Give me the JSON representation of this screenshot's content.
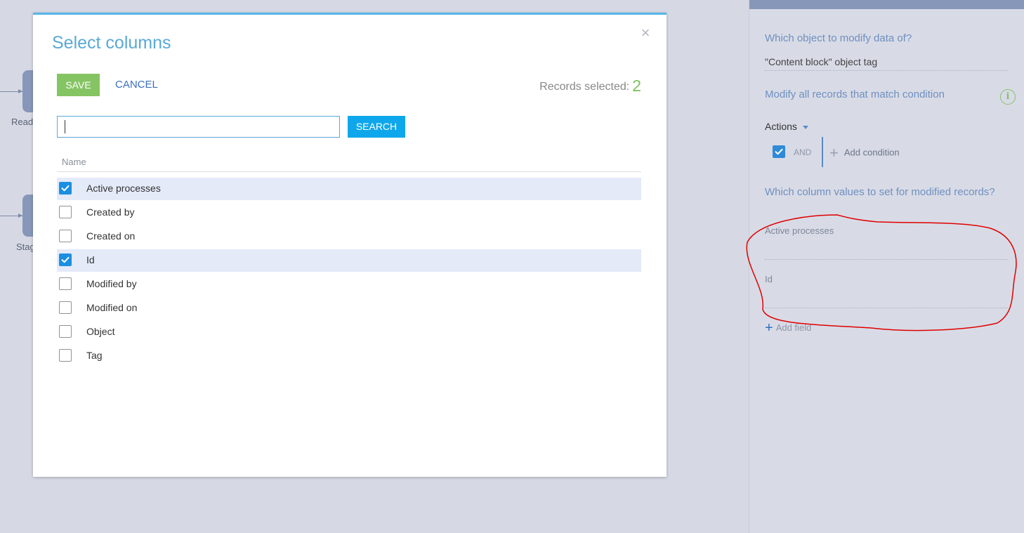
{
  "background": {
    "nodes": [
      {
        "label": "Read"
      },
      {
        "label": "Stag"
      }
    ]
  },
  "modal": {
    "title": "Select columns",
    "close_symbol": "×",
    "save_label": "SAVE",
    "cancel_label": "CANCEL",
    "records_selected_label": "Records selected:",
    "records_selected_count": "2",
    "search": {
      "value": "",
      "placeholder": ""
    },
    "search_button_label": "SEARCH",
    "column_header": "Name",
    "columns": [
      {
        "label": "Active processes",
        "checked": true
      },
      {
        "label": "Created by",
        "checked": false
      },
      {
        "label": "Created on",
        "checked": false
      },
      {
        "label": "Id",
        "checked": true
      },
      {
        "label": "Modified by",
        "checked": false
      },
      {
        "label": "Modified on",
        "checked": false
      },
      {
        "label": "Object",
        "checked": false
      },
      {
        "label": "Tag",
        "checked": false
      }
    ]
  },
  "right_panel": {
    "object_question": "Which object to modify data of?",
    "object_value": "\"Content block\" object tag",
    "condition_label": "Modify all records that match condition",
    "info_icon": "i",
    "actions_label": "Actions",
    "and_label": "AND",
    "add_condition_label": "Add condition",
    "columns_question": "Which column values to set for modified records?",
    "fields": [
      {
        "label": "Active processes"
      },
      {
        "label": "Id"
      }
    ],
    "add_field_label": "Add field"
  },
  "colors": {
    "accent_blue": "#5aa9d6",
    "save_green": "#85c463",
    "search_blue": "#0fa7ec",
    "checked_blue": "#1b8fe0",
    "selected_row": "#e4eaf8",
    "count_green": "#7cc05c",
    "annotation_red": "#e00000"
  },
  "icons": [
    "close-icon",
    "checkmark-icon",
    "info-icon",
    "caret-down-icon",
    "plus-icon"
  ]
}
